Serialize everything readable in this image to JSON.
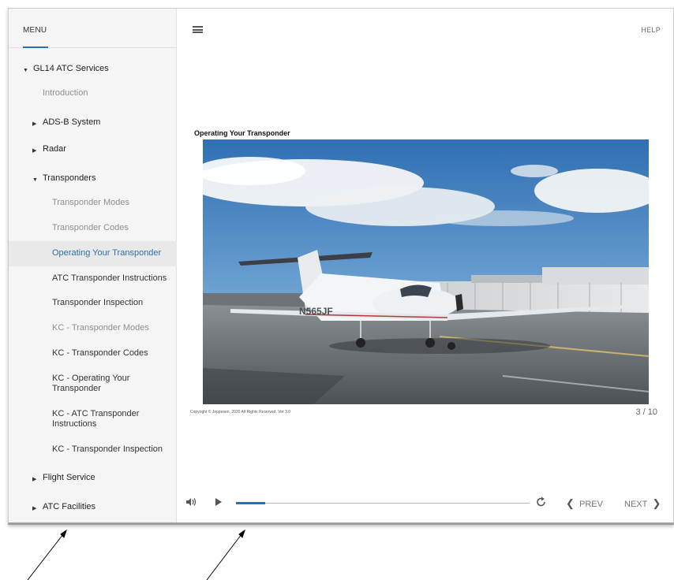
{
  "sidebar": {
    "menu_title": "MENU",
    "course": {
      "label": "GL14 ATC Services"
    },
    "items": [
      {
        "label": "Introduction"
      },
      {
        "label": "ADS-B System"
      },
      {
        "label": "Radar"
      },
      {
        "label": "Transponders"
      },
      {
        "label": "Transponder Modes"
      },
      {
        "label": "Transponder Codes"
      },
      {
        "label": "Operating Your Transponder"
      },
      {
        "label": "ATC Transponder Instructions"
      },
      {
        "label": "Transponder Inspection"
      },
      {
        "label": "KC - Transponder Modes"
      },
      {
        "label": "KC - Transponder Codes"
      },
      {
        "label": "KC - Operating Your Transponder"
      },
      {
        "label": "KC - ATC Transponder Instructions"
      },
      {
        "label": "KC - Transponder Inspection"
      },
      {
        "label": "Flight Service"
      },
      {
        "label": "ATC Facilities"
      }
    ]
  },
  "header": {
    "help_label": "HELP"
  },
  "slide": {
    "title": "Operating Your Transponder",
    "copyright": "Copyright © Jeppesen, 2020 All Rights Reserved. Ver 3.0",
    "page_indicator": "3 / 10",
    "aircraft_registration": "N565JF"
  },
  "controls": {
    "progress_fraction": 0.1,
    "prev_label": "PREV",
    "next_label": "NEXT"
  },
  "icons": {
    "menu": "hamburger-icon",
    "volume": "volume-icon",
    "play": "play-icon",
    "replay": "replay-icon",
    "prev": "chevron-left-icon",
    "next": "chevron-right-icon"
  },
  "colors": {
    "accent": "#2a6fb0",
    "sidebar_bg": "#f5f5f5",
    "active_item_bg": "#e9e9e9"
  }
}
